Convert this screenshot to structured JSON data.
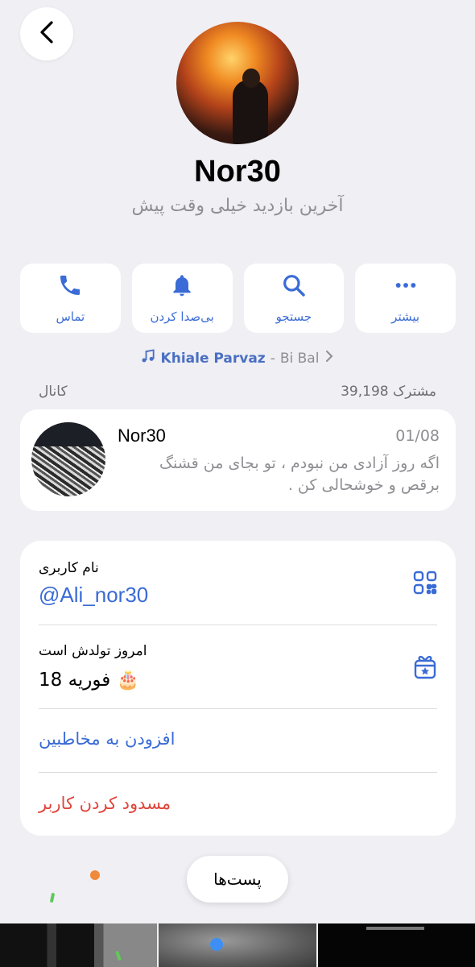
{
  "header": {
    "back_icon": "chevron-left-icon"
  },
  "profile": {
    "name": "Nor30",
    "status": "آخرین بازدید خیلی وقت پیش"
  },
  "actions": [
    {
      "label": "تماس",
      "icon": "phone-icon"
    },
    {
      "label": "بی‌صدا کردن",
      "icon": "bell-icon"
    },
    {
      "label": "جستجو",
      "icon": "search-icon"
    },
    {
      "label": "بیشتر",
      "icon": "more-icon"
    }
  ],
  "music": {
    "title": "Khiale Parvaz",
    "separator": "-",
    "artist": "Bi Bal"
  },
  "channel_section": {
    "label": "کانال",
    "subscribers": "39,198 مشترک"
  },
  "channel": {
    "name": "Nor30",
    "date": "01/08",
    "message": "اگه روز آزادی من نبودم ، تو بجای من قشنگ برقص و خوشحالی کن ."
  },
  "info": {
    "username_label": "نام کاربری",
    "username": "@Ali_nor30",
    "birthday_label": "امروز تولدش است",
    "birthday": "18 فوریه 🎂",
    "add_contact": "افزودن به مخاطبین",
    "block_user": "مسدود کردن کاربر"
  },
  "tabs": {
    "posts": "پست‌ها"
  },
  "colors": {
    "accent": "#3a6bd6",
    "danger": "#e0443a",
    "background": "#efeff4",
    "secondary_text": "#8e8e93"
  }
}
